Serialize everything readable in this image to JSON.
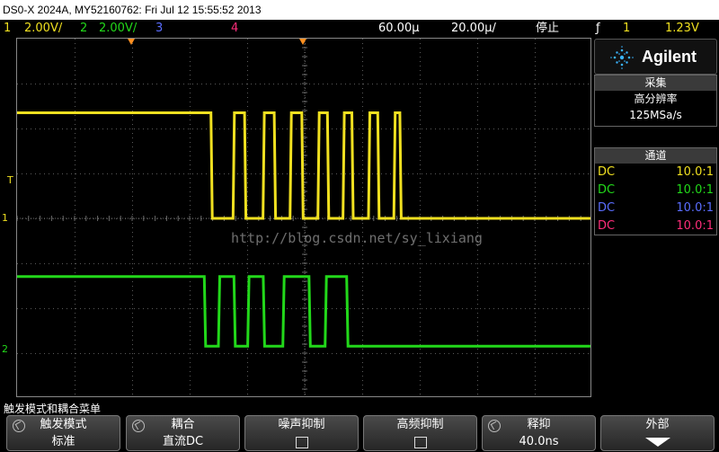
{
  "window": {
    "title": "DS0-X 2024A, MY52160762: Fri Jul 12 15:55:52 2013"
  },
  "status": {
    "ch1_num": "1",
    "ch1_scale": "2.00V/",
    "ch2_num": "2",
    "ch2_scale": "2.00V/",
    "ch3_num": "3",
    "ch4_num": "4",
    "time_offset": "60.00µ",
    "time_scale": "20.00µ/",
    "run_state": "停止",
    "trig_icon": "ƒ",
    "trig_source": "1",
    "trig_level": "1.23V"
  },
  "brand": {
    "name": "Agilent",
    "icon": "spark-icon"
  },
  "acquisition": {
    "header": "采集",
    "mode": "高分辨率",
    "rate": "125MSa/s"
  },
  "channels_panel": {
    "header": "通道",
    "rows": [
      {
        "coupling": "DC",
        "probe": "10.0:1"
      },
      {
        "coupling": "DC",
        "probe": "10.0:1"
      },
      {
        "coupling": "DC",
        "probe": "10.0:1"
      },
      {
        "coupling": "DC",
        "probe": "10.0:1"
      }
    ]
  },
  "screen": {
    "watermark": "http://blog.csdn.net/sy_lixiang",
    "ch1_marker": "1",
    "ch2_marker": "2",
    "trig_marker": "T"
  },
  "menu_title": "触发模式和耦合菜单",
  "softkeys": [
    {
      "title": "触发模式",
      "value": "标准"
    },
    {
      "title": "耦合",
      "value": "直流DC"
    },
    {
      "title": "噪声抑制",
      "value": ""
    },
    {
      "title": "高频抑制",
      "value": ""
    },
    {
      "title": "释抑",
      "value": "40.0ns"
    },
    {
      "title": "外部",
      "value": ""
    }
  ],
  "colors": {
    "ch1": "#f0e020",
    "ch2": "#22d81a",
    "ch3": "#5a6dff",
    "ch4": "#ff2d7a",
    "marker_orange": "#ff9020"
  },
  "waveforms": {
    "ch1_edges_us": [
      -32.6,
      -24.9,
      -20.9,
      -14.5,
      -10.6,
      -5.1,
      -1.0,
      4.6,
      7.9,
      13.3,
      16.4,
      22.2,
      25.4,
      31.0,
      33.1
    ],
    "ch1_start_level": "high",
    "ch1_high_v": 4.7,
    "ch1_low_v": 0.0,
    "ch2_edges_us": [
      -34.9,
      -30.0,
      -24.6,
      -19.8,
      -14.4,
      -7.6,
      1.5,
      7.1,
      14.6
    ],
    "ch2_start_level": "high",
    "ch2_high_v": 3.25,
    "ch2_low_v": 0.15
  }
}
